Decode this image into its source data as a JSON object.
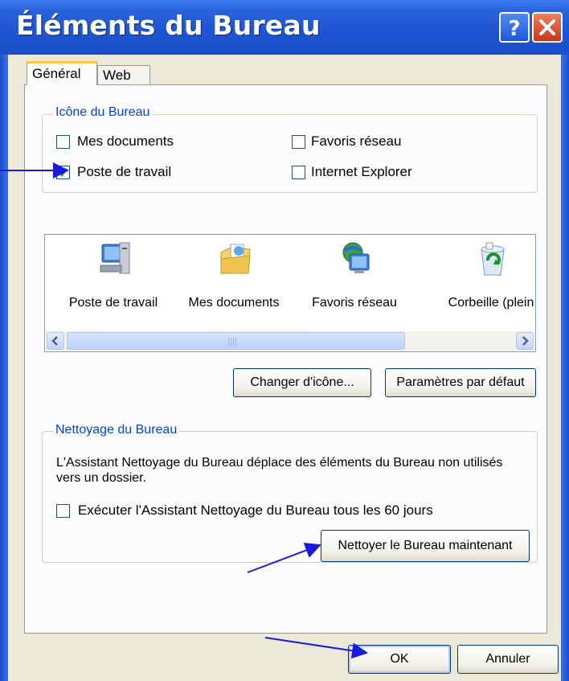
{
  "window": {
    "title": "Éléments du Bureau"
  },
  "tabs": [
    {
      "label": "Général"
    },
    {
      "label": "Web"
    }
  ],
  "desktop_icons_group": {
    "legend": "Icône du Bureau",
    "checkboxes": [
      {
        "label": "Mes documents",
        "checked": false
      },
      {
        "label": "Favoris réseau",
        "checked": false
      },
      {
        "label": "Poste de travail",
        "checked": true
      },
      {
        "label": "Internet Explorer",
        "checked": false
      }
    ]
  },
  "icon_list": {
    "items": [
      {
        "label": "Poste de travail",
        "icon": "computer-icon"
      },
      {
        "label": "Mes documents",
        "icon": "documents-folder-icon"
      },
      {
        "label": "Favoris réseau",
        "icon": "network-places-icon"
      },
      {
        "label": "Corbeille (plein",
        "icon": "recycle-bin-full-icon"
      }
    ]
  },
  "icon_buttons": {
    "change_icon": "Changer d'icône...",
    "restore_default": "Paramètres par défaut"
  },
  "cleanup_group": {
    "legend": "Nettoyage du Bureau",
    "description": "L'Assistant Nettoyage du Bureau déplace des éléments du Bureau non utilisés vers un dossier.",
    "run_every_label": "Exécuter l'Assistant Nettoyage du Bureau tous les 60 jours",
    "run_every_checked": false,
    "clean_now_button": "Nettoyer le Bureau maintenant"
  },
  "footer": {
    "ok": "OK",
    "cancel": "Annuler"
  },
  "colors": {
    "title_bar": "#1f55d3",
    "group_legend": "#0046d5",
    "dialog_face": "#ece9d8",
    "annotation_arrow": "#1a1adc"
  }
}
